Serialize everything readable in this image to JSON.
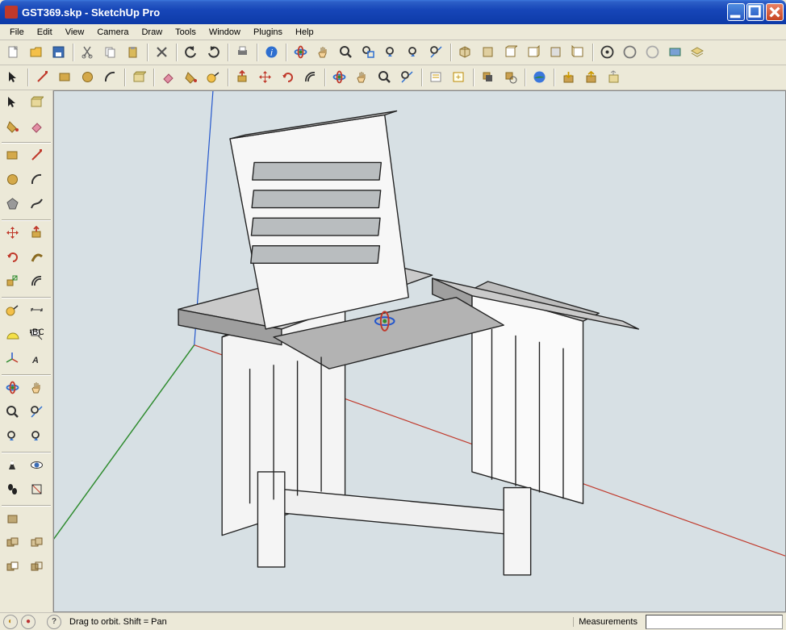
{
  "window": {
    "title": "GST369.skp - SketchUp Pro"
  },
  "menu": {
    "items": [
      "File",
      "Edit",
      "View",
      "Camera",
      "Draw",
      "Tools",
      "Window",
      "Plugins",
      "Help"
    ]
  },
  "toolbar_top1": {
    "items": [
      {
        "name": "new-file-icon"
      },
      {
        "name": "open-file-icon"
      },
      {
        "name": "save-file-icon"
      },
      {
        "sep": true
      },
      {
        "name": "cut-icon"
      },
      {
        "name": "copy-icon"
      },
      {
        "name": "paste-icon"
      },
      {
        "sep": true
      },
      {
        "name": "delete-icon"
      },
      {
        "sep": true
      },
      {
        "name": "undo-icon"
      },
      {
        "name": "redo-icon"
      },
      {
        "sep": true
      },
      {
        "name": "print-icon"
      },
      {
        "sep": true
      },
      {
        "name": "model-info-icon"
      },
      {
        "sep": true
      },
      {
        "name": "orbit-icon"
      },
      {
        "name": "pan-icon"
      },
      {
        "name": "zoom-icon"
      },
      {
        "name": "zoom-window-icon"
      },
      {
        "name": "zoom-previous-icon"
      },
      {
        "name": "zoom-next-icon"
      },
      {
        "name": "zoom-extents-icon"
      },
      {
        "sep": true
      },
      {
        "name": "iso-view-icon"
      },
      {
        "name": "top-view-icon"
      },
      {
        "name": "front-view-icon"
      },
      {
        "name": "right-view-icon"
      },
      {
        "name": "back-view-icon"
      },
      {
        "name": "left-view-icon"
      },
      {
        "sep": true
      },
      {
        "name": "get-models-icon"
      },
      {
        "name": "share-model-icon"
      },
      {
        "name": "get-photo-icon"
      },
      {
        "name": "preview-ge-icon"
      },
      {
        "name": "layer-icon"
      }
    ]
  },
  "toolbar_top2": {
    "items": [
      {
        "name": "select-icon"
      },
      {
        "sep": true
      },
      {
        "name": "line-icon"
      },
      {
        "name": "rectangle-icon"
      },
      {
        "name": "circle-icon"
      },
      {
        "name": "arc-icon"
      },
      {
        "sep": true
      },
      {
        "name": "component-icon"
      },
      {
        "sep": true
      },
      {
        "name": "eraser-icon"
      },
      {
        "name": "paint-bucket-icon"
      },
      {
        "name": "tape-measure-icon"
      },
      {
        "sep": true
      },
      {
        "name": "push-pull-icon"
      },
      {
        "name": "move-icon"
      },
      {
        "name": "rotate-icon"
      },
      {
        "name": "offset-icon"
      },
      {
        "sep": true
      },
      {
        "name": "orbit-icon"
      },
      {
        "name": "pan-icon"
      },
      {
        "name": "zoom-icon"
      },
      {
        "name": "zoom-extents-icon"
      },
      {
        "sep": true
      },
      {
        "name": "outliner-icon"
      },
      {
        "name": "add-scene-icon"
      },
      {
        "sep": true
      },
      {
        "name": "shadow-toggle-icon"
      },
      {
        "name": "shadow-settings-icon"
      },
      {
        "sep": true
      },
      {
        "name": "google-earth-icon"
      },
      {
        "sep": true
      },
      {
        "name": "warehouse-get-icon"
      },
      {
        "name": "warehouse-upload-icon"
      },
      {
        "name": "share-component-icon"
      }
    ]
  },
  "side_tools": {
    "groups": [
      {
        "items": [
          {
            "name": "select-icon"
          },
          {
            "name": "component-icon"
          }
        ]
      },
      {
        "items": [
          {
            "name": "paint-bucket-icon"
          },
          {
            "name": "eraser-icon"
          }
        ]
      },
      {
        "sep": true
      },
      {
        "items": [
          {
            "name": "rectangle-icon"
          },
          {
            "name": "line-icon"
          }
        ]
      },
      {
        "items": [
          {
            "name": "circle-icon"
          },
          {
            "name": "arc-icon"
          }
        ]
      },
      {
        "items": [
          {
            "name": "polygon-icon"
          },
          {
            "name": "freehand-icon"
          }
        ]
      },
      {
        "sep": true
      },
      {
        "items": [
          {
            "name": "move-icon"
          },
          {
            "name": "push-pull-icon"
          }
        ]
      },
      {
        "items": [
          {
            "name": "rotate-icon"
          },
          {
            "name": "follow-me-icon"
          }
        ]
      },
      {
        "items": [
          {
            "name": "scale-icon"
          },
          {
            "name": "offset-icon"
          }
        ]
      },
      {
        "sep": true
      },
      {
        "items": [
          {
            "name": "tape-measure-icon"
          },
          {
            "name": "dimension-icon"
          }
        ]
      },
      {
        "items": [
          {
            "name": "protractor-icon"
          },
          {
            "name": "text-label-icon"
          }
        ]
      },
      {
        "items": [
          {
            "name": "axes-icon"
          },
          {
            "name": "3d-text-icon"
          }
        ]
      },
      {
        "sep": true
      },
      {
        "items": [
          {
            "name": "orbit-icon"
          },
          {
            "name": "pan-icon"
          }
        ]
      },
      {
        "items": [
          {
            "name": "zoom-icon"
          },
          {
            "name": "zoom-extents-icon"
          }
        ]
      },
      {
        "items": [
          {
            "name": "zoom-previous-icon"
          },
          {
            "name": "zoom-next-icon"
          }
        ]
      },
      {
        "sep": true
      },
      {
        "items": [
          {
            "name": "position-camera-icon"
          },
          {
            "name": "look-around-icon"
          }
        ]
      },
      {
        "items": [
          {
            "name": "walk-icon"
          },
          {
            "name": "section-plane-icon"
          }
        ]
      },
      {
        "sep": true
      },
      {
        "items": [
          {
            "name": "solid-outer-icon"
          }
        ]
      },
      {
        "items": [
          {
            "name": "solid-intersect-icon"
          },
          {
            "name": "solid-union-icon"
          }
        ]
      },
      {
        "items": [
          {
            "name": "solid-subtract-icon"
          },
          {
            "name": "solid-trim-icon"
          }
        ]
      }
    ]
  },
  "status": {
    "hint": "Drag to orbit.  Shift = Pan",
    "vcb_label": "Measurements",
    "vcb_value": ""
  },
  "viewport": {
    "model": "Morris chair",
    "axes": [
      "red",
      "green",
      "blue"
    ]
  }
}
